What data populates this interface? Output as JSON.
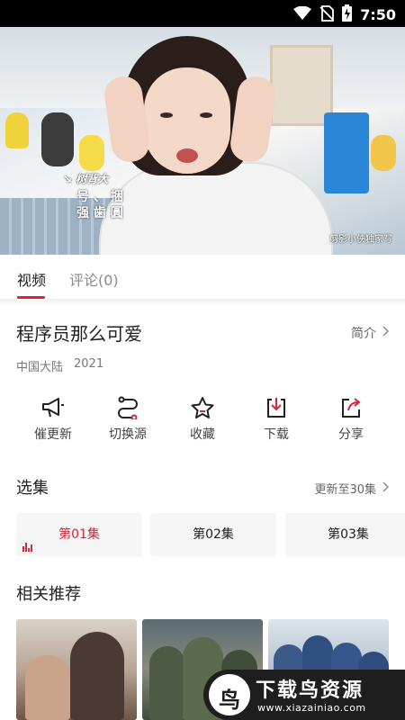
{
  "status_bar": {
    "time": "7:50",
    "icons": [
      "wifi-icon",
      "no-sim-icon",
      "battery-charging-icon"
    ]
  },
  "video": {
    "caption_a": "↘ 树背大",
    "caption_b": "号 、 捆",
    "caption_c": "强 歯 圓",
    "watermark": "剪影小侠独家写"
  },
  "tabs": [
    {
      "label": "视频",
      "active": true
    },
    {
      "label": "评论(0)",
      "active": false
    }
  ],
  "show": {
    "title": "程序员那么可爱",
    "intro_label": "简介",
    "region": "中国大陆",
    "year": "2021"
  },
  "actions": [
    {
      "label": "催更新",
      "icon": "megaphone-icon"
    },
    {
      "label": "切换源",
      "icon": "switch-source-icon"
    },
    {
      "label": "收藏",
      "icon": "star-icon"
    },
    {
      "label": "下载",
      "icon": "download-icon"
    },
    {
      "label": "分享",
      "icon": "share-icon"
    }
  ],
  "episodes_section": {
    "title": "选集",
    "update_status": "更新至30集"
  },
  "episodes": [
    {
      "label": "第01集",
      "active": true
    },
    {
      "label": "第02集",
      "active": false
    },
    {
      "label": "第03集",
      "active": false
    }
  ],
  "recommend_section": {
    "title": "相关推荐"
  },
  "brand": {
    "logo_glyph": "鸟",
    "name": "下载鸟资源",
    "url": "www.xiazainiao.com"
  },
  "colors": {
    "accent": "#d3263c",
    "status_bar": "#000000",
    "text_primary": "#222222",
    "text_secondary": "#777777"
  }
}
